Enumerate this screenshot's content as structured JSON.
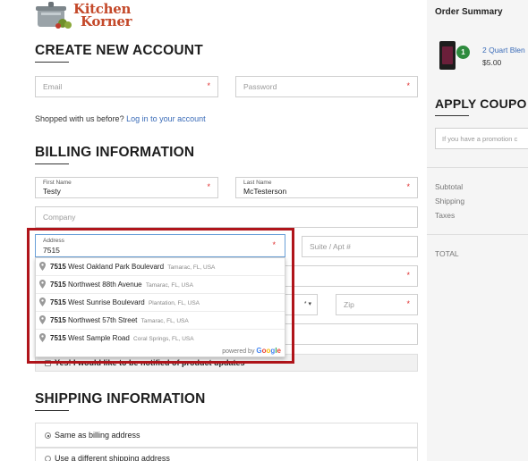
{
  "logo": {
    "line1": "Kitchen",
    "line2": "Korner"
  },
  "account": {
    "title": "CREATE NEW ACCOUNT",
    "email_placeholder": "Email",
    "password_placeholder": "Password",
    "required_mark": "*",
    "shopped_text": "Shopped with us before?",
    "login_link": "Log in to your account"
  },
  "billing": {
    "title": "BILLING INFORMATION",
    "first_name_label": "First Name",
    "first_name_value": "Testy",
    "last_name_label": "Last Name",
    "last_name_value": "McTesterson",
    "company_placeholder": "Company",
    "address_label": "Address",
    "address_value": "7515",
    "suite_placeholder": "Suite / Apt #",
    "zip_placeholder": "Zip",
    "newsletter_text": "Yes! I would like to be notified of product updates"
  },
  "autocomplete": {
    "items": [
      {
        "match": "7515",
        "rest": " West Oakland Park Boulevard",
        "secondary": "Tamarac, FL, USA"
      },
      {
        "match": "7515",
        "rest": " Northwest 88th Avenue",
        "secondary": "Tamarac, FL, USA"
      },
      {
        "match": "7515",
        "rest": " West Sunrise Boulevard",
        "secondary": "Plantation, FL, USA"
      },
      {
        "match": "7515",
        "rest": " Northwest 57th Street",
        "secondary": "Tamarac, FL, USA"
      },
      {
        "match": "7515",
        "rest": " West Sample Road",
        "secondary": "Coral Springs, FL, USA"
      }
    ],
    "powered_by": "powered by",
    "google": [
      "G",
      "o",
      "o",
      "g",
      "l",
      "e"
    ],
    "border_color": "#b0141a"
  },
  "shipping": {
    "title": "SHIPPING INFORMATION",
    "option_same": "Same as billing address",
    "option_different": "Use a different shipping address"
  },
  "order": {
    "title": "Order Summary",
    "item_qty": "1",
    "item_name": "2 Quart Blen",
    "item_price": "$5.00",
    "coupon_title": "APPLY COUPO",
    "coupon_placeholder": "If you have a promotion c",
    "subtotal_label": "Subtotal",
    "shipping_label": "Shipping",
    "taxes_label": "Taxes",
    "total_label": "TOTAL"
  },
  "colors": {
    "accent_link": "#3b6cb8",
    "required": "#e03030",
    "badge": "#2e8b3e"
  }
}
